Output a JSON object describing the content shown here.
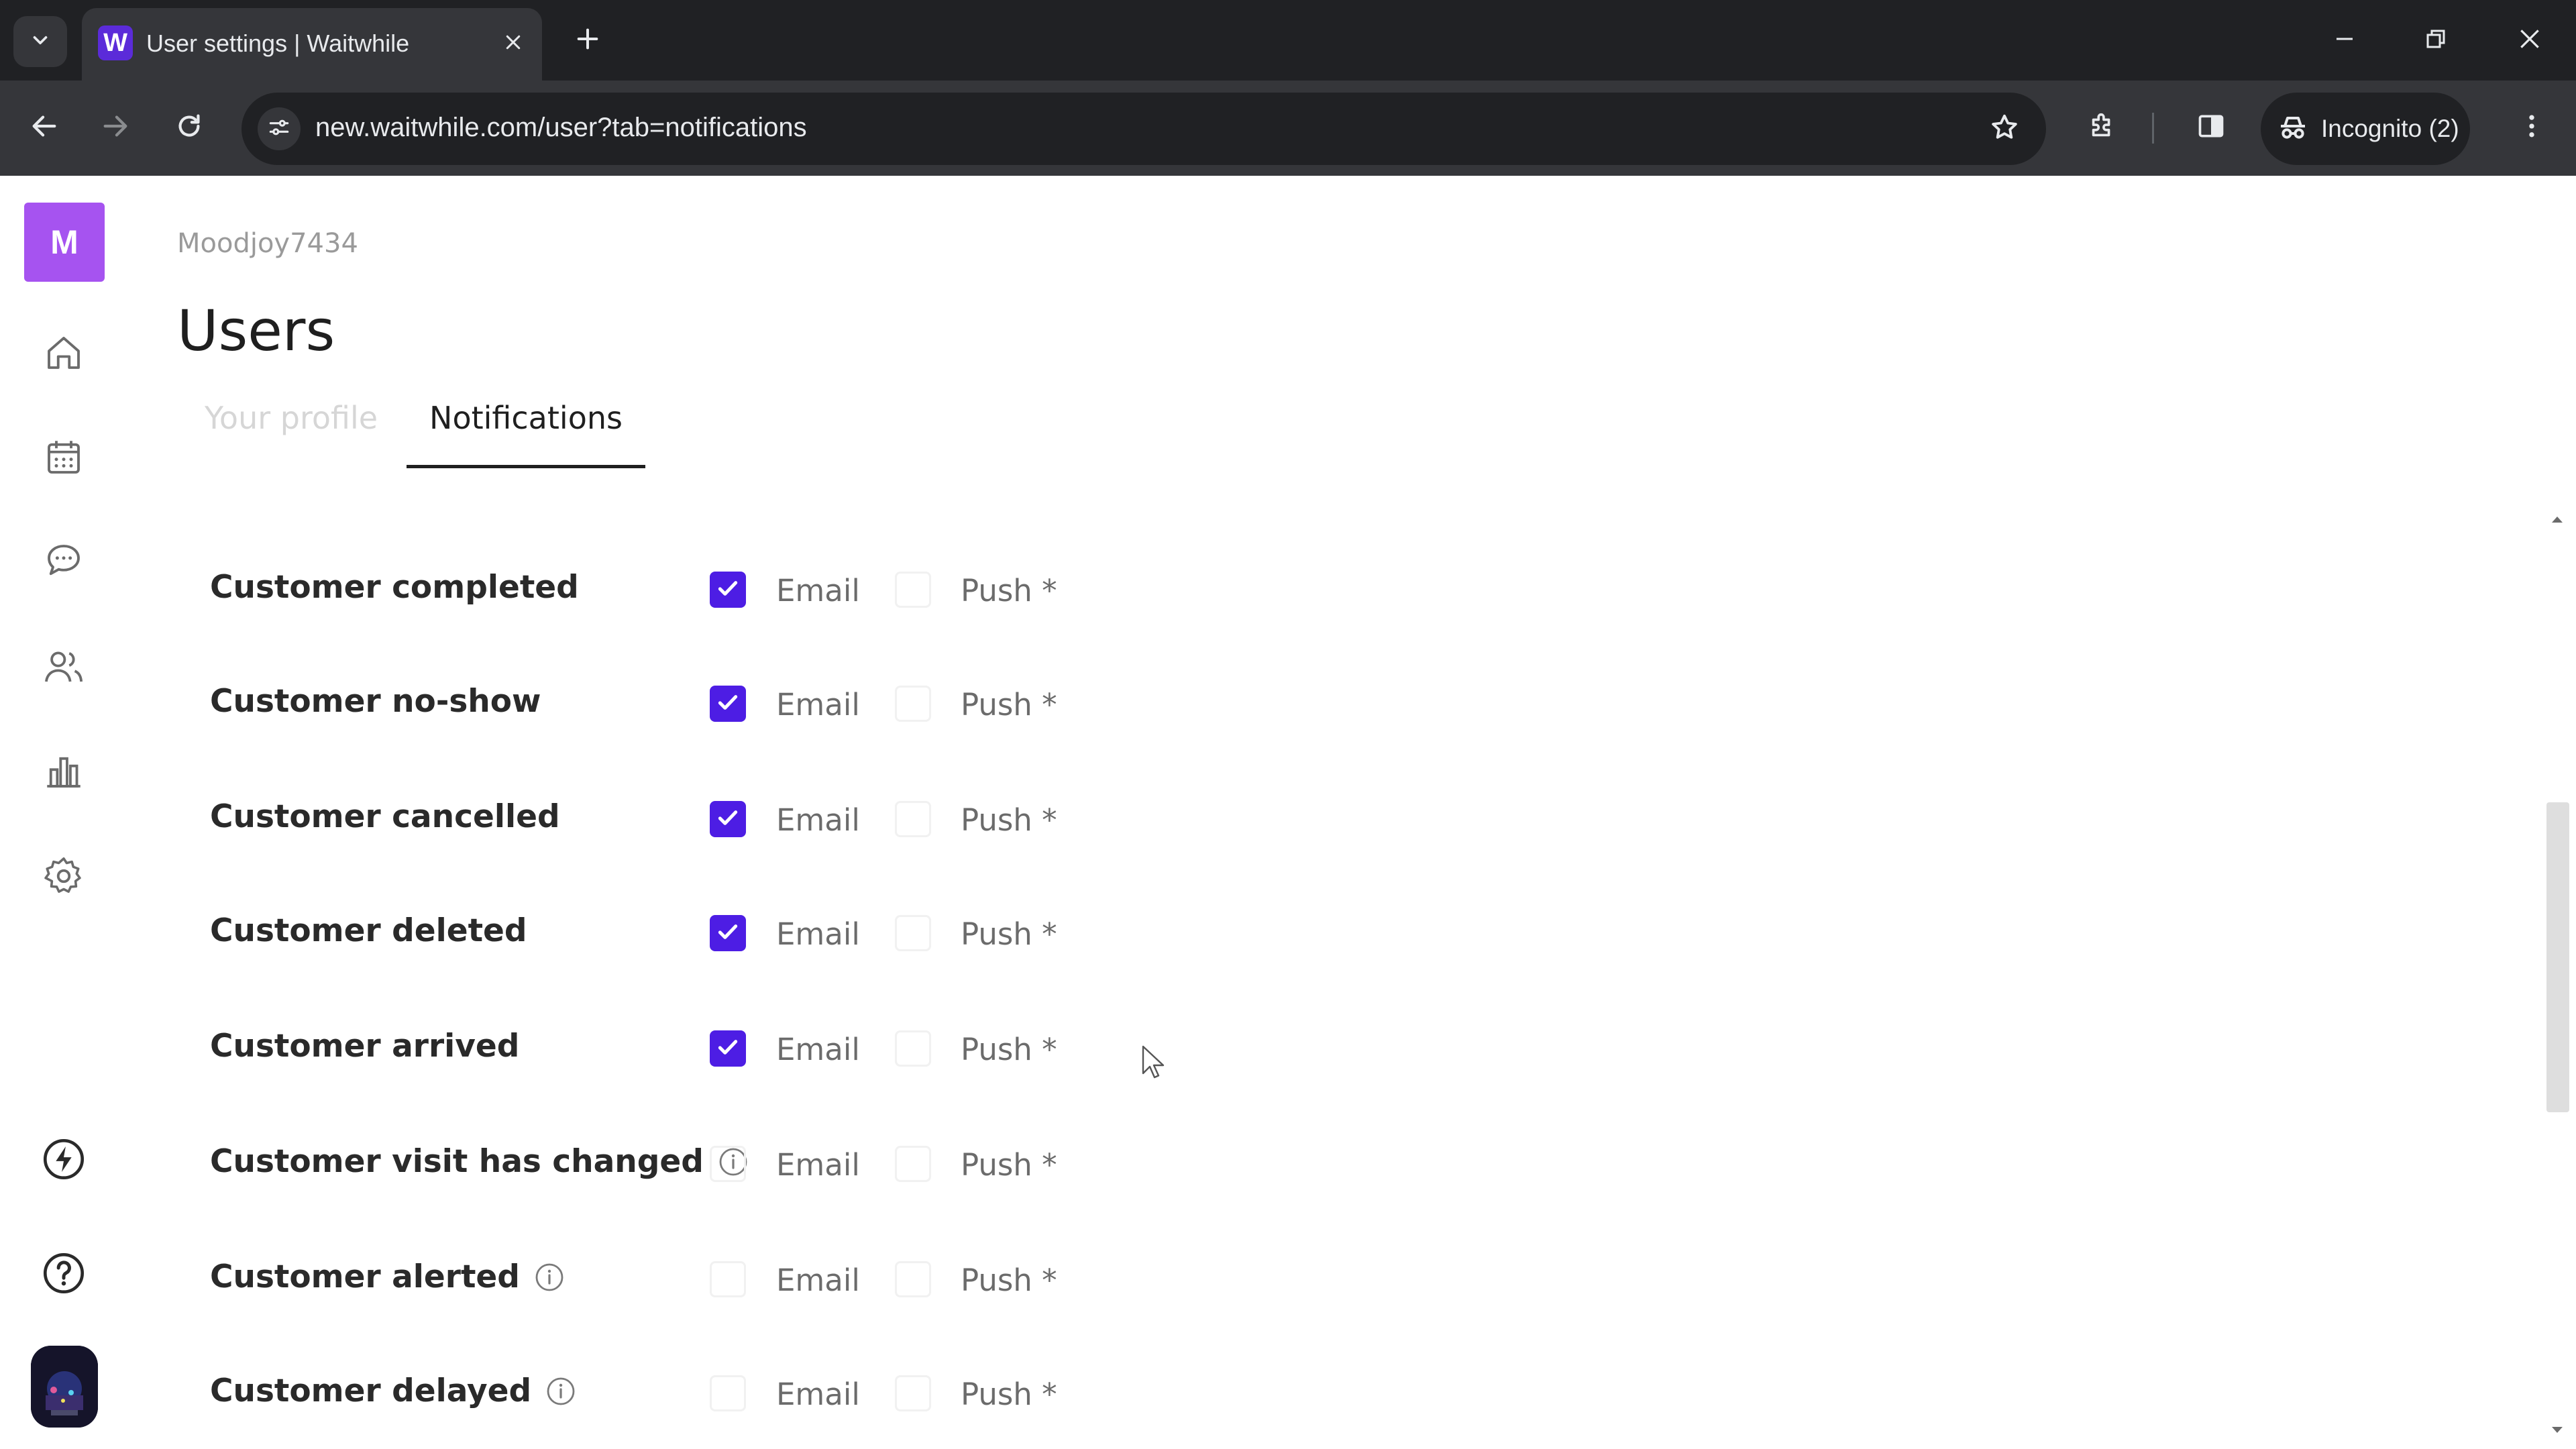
{
  "browser": {
    "tab_title": "User settings | Waitwhile",
    "favicon_letter": "W",
    "url": "new.waitwhile.com/user?tab=notifications",
    "incognito_label": "Incognito (2)",
    "icons": [
      "tab-search-icon",
      "close-icon",
      "plus-icon",
      "minimize-icon",
      "restore-icon",
      "close-window-icon",
      "back-icon",
      "forward-icon",
      "reload-icon",
      "site-info-icon",
      "star-icon",
      "extensions-icon",
      "side-panel-icon",
      "incognito-icon",
      "kebab-menu-icon"
    ]
  },
  "sidebar": {
    "logo_letter": "M",
    "nav_icons": [
      "home-icon",
      "calendar-icon",
      "chat-icon",
      "users-icon",
      "analytics-icon",
      "settings-icon",
      "lightning-icon",
      "help-icon"
    ]
  },
  "main": {
    "breadcrumb": "Moodjoy7434",
    "title": "Users",
    "tabs": [
      {
        "label": "Your profile",
        "active": false
      },
      {
        "label": "Notifications",
        "active": true
      }
    ],
    "option_labels": {
      "email": "Email",
      "push": "Push *"
    },
    "rows": [
      {
        "label": "Customer completed",
        "info": false,
        "email": true,
        "push": false
      },
      {
        "label": "Customer no-show",
        "info": false,
        "email": true,
        "push": false
      },
      {
        "label": "Customer cancelled",
        "info": false,
        "email": true,
        "push": false
      },
      {
        "label": "Customer deleted",
        "info": false,
        "email": true,
        "push": false
      },
      {
        "label": "Customer arrived",
        "info": false,
        "email": true,
        "push": false
      },
      {
        "label": "Customer visit has changed",
        "info": true,
        "email": false,
        "push": false
      },
      {
        "label": "Customer alerted",
        "info": true,
        "email": false,
        "push": false
      },
      {
        "label": "Customer delayed",
        "info": true,
        "email": false,
        "push": false
      }
    ]
  },
  "colors": {
    "accent": "#4d1de4",
    "logo": "#a653f0",
    "chrome_dark": "#202124",
    "chrome_toolbar": "#35363a"
  }
}
